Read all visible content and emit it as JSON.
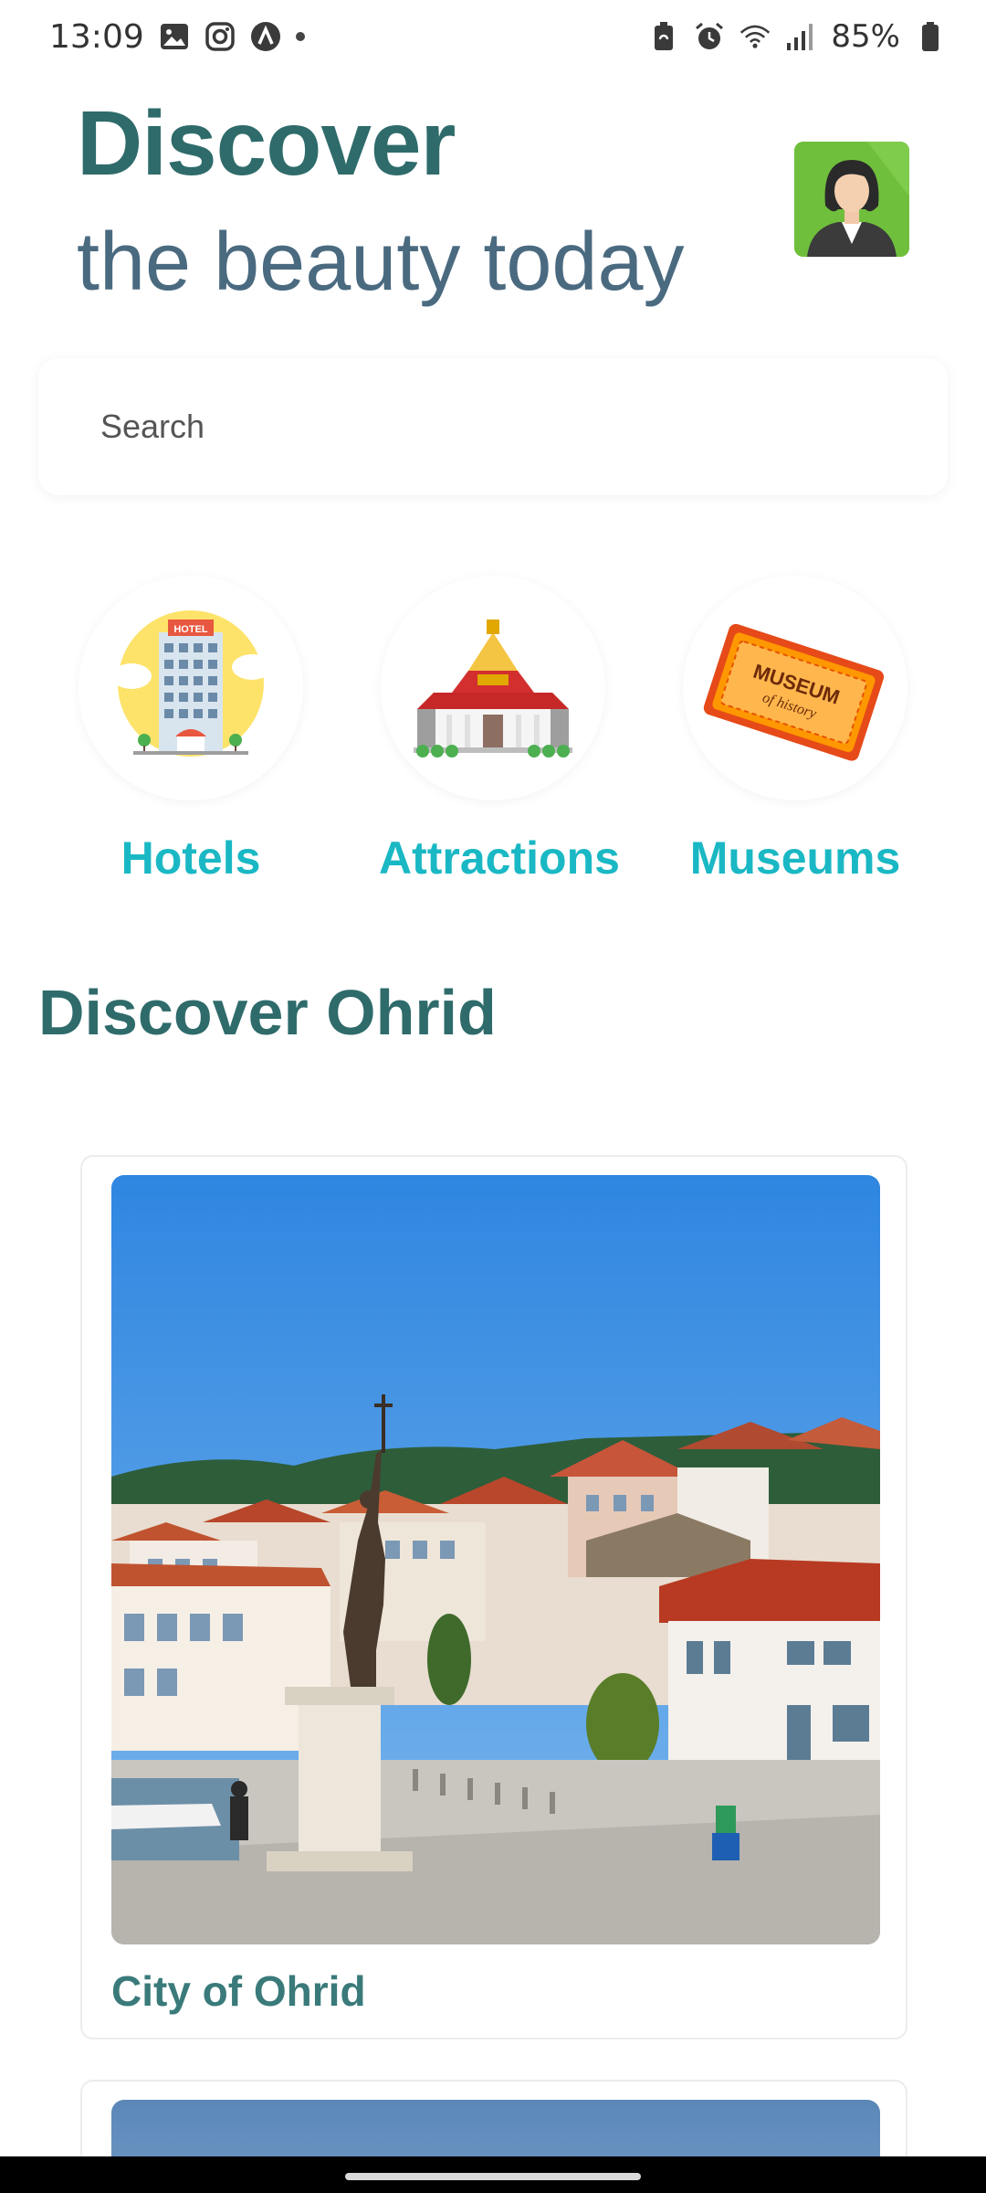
{
  "status_bar": {
    "time": "13:09",
    "left_icons": [
      "gallery-icon",
      "instagram-icon",
      "app-icon",
      "dot-icon"
    ],
    "right_icons": [
      "battery-saver-icon",
      "alarm-icon",
      "wifi-icon",
      "signal-icon"
    ],
    "battery_text": "85%"
  },
  "header": {
    "title": "Discover",
    "subtitle": "the beauty today",
    "avatar_icon": "user-avatar-icon"
  },
  "search": {
    "placeholder": "Search",
    "value": ""
  },
  "categories": [
    {
      "label": "Hotels",
      "icon": "hotel-icon"
    },
    {
      "label": "Attractions",
      "icon": "temple-icon"
    },
    {
      "label": "Museums",
      "icon": "museum-ticket-icon"
    }
  ],
  "museum_ticket_text": {
    "line1": "MUSEUM",
    "line2": "of history"
  },
  "hotel_sign": "HOTEL",
  "section": {
    "title": "Discover Ohrid"
  },
  "cards": [
    {
      "title": "City of Ohrid"
    }
  ],
  "colors": {
    "title": "#2f6b6b",
    "subtitle": "#4a6a80",
    "category_label": "#1ab8c4",
    "avatar_bg": "#6fbf3c"
  }
}
